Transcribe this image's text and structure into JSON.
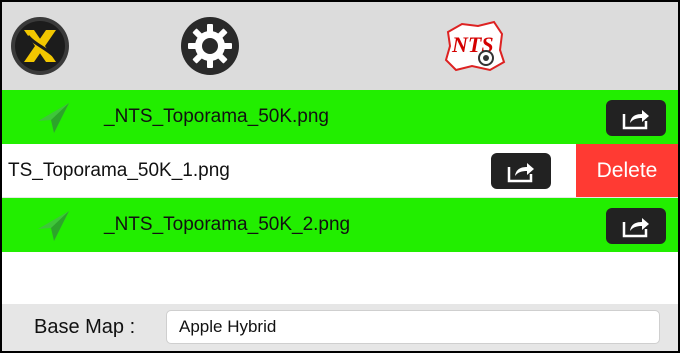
{
  "toolbar": {
    "logo_icon": "x-logo-icon",
    "settings_icon": "gear-icon",
    "nts_icon": "nts-icon",
    "nts_label": "NTS"
  },
  "files": [
    {
      "name": "_NTS_Toporama_50K.png",
      "highlighted": true,
      "action_icon": "share-icon"
    },
    {
      "name": "TS_Toporama_50K_1.png",
      "highlighted": false,
      "swiped": true,
      "action_icon": "share-icon",
      "delete_label": "Delete"
    },
    {
      "name": "_NTS_Toporama_50K_2.png",
      "highlighted": true,
      "action_icon": "share-icon"
    }
  ],
  "base_map": {
    "label": "Base Map :",
    "value": "Apple Hybrid"
  },
  "colors": {
    "highlight": "#22ee00",
    "delete": "#ff3a33",
    "toolbar": "#dcdcdc",
    "share_button": "#222222"
  }
}
